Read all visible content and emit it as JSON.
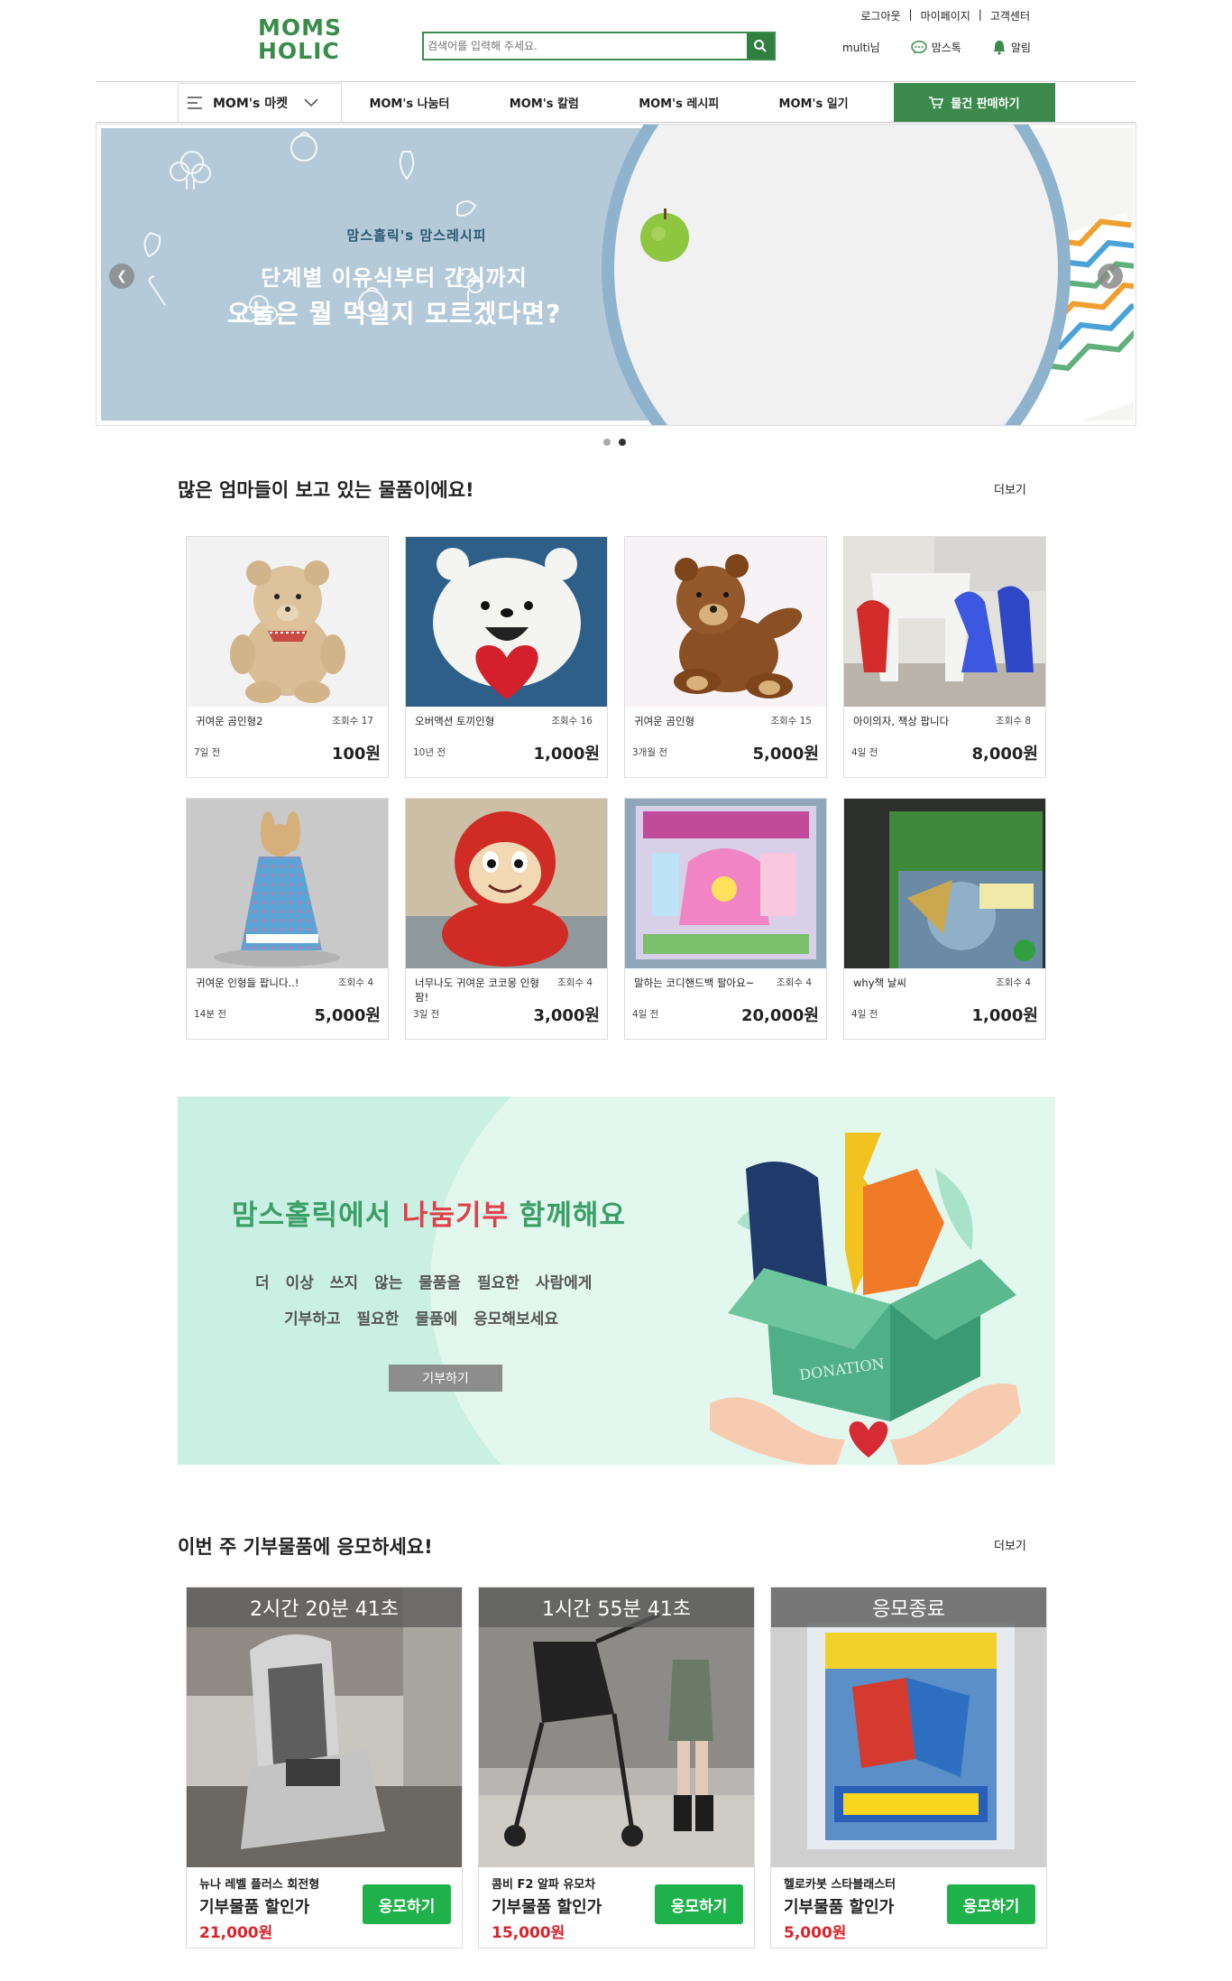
{
  "header": {
    "logo_line1": "MOMS",
    "logo_line2": "HOLIC",
    "search_placeholder": "검색어를 입력해 주세요.",
    "top_links": [
      "로그아웃",
      "마이페이지",
      "고객센터"
    ],
    "username": "multi님",
    "chat_label": "맘스톡",
    "alarm_label": "알림"
  },
  "nav": {
    "category": "MOM's 마켓",
    "items": [
      "MOM's 나눔터",
      "MOM's 칼럼",
      "MOM's 레시피",
      "MOM's 일기"
    ],
    "sell_button": "물건 판매하기"
  },
  "hero": {
    "small": "맘스홀릭's 맘스레시피",
    "line1": "단계별 이유식부터 간식까지",
    "line2": "오늘은 뭘 먹일지 모르겠다면?",
    "slides": 2,
    "active_slide": 2
  },
  "popular": {
    "title": "많은 엄마들이 보고 있는 물품이에요!",
    "more": "더보기",
    "items": [
      {
        "name": "귀여운 곰인형2",
        "views": "조회수 17",
        "time": "7일 전",
        "price": "100원"
      },
      {
        "name": "오버액션 토끼인형",
        "views": "조회수 16",
        "time": "10년 전",
        "price": "1,000원"
      },
      {
        "name": "귀여운 곰인형",
        "views": "조회수 15",
        "time": "3개월 전",
        "price": "5,000원"
      },
      {
        "name": "아이의자, 책상 팝니다",
        "views": "조회수 8",
        "time": "4일 전",
        "price": "8,000원"
      },
      {
        "name": "귀여운 인형들 팝니다..!",
        "views": "조회수 4",
        "time": "14분 전",
        "price": "5,000원"
      },
      {
        "name": "너무나도 귀여운 코코몽 인형 팜!",
        "views": "조회수 4",
        "time": "3일 전",
        "price": "3,000원"
      },
      {
        "name": "말하는 코디핸드백 팔아요~",
        "views": "조회수 4",
        "time": "4일 전",
        "price": "20,000원"
      },
      {
        "name": "why책 날씨",
        "views": "조회수 4",
        "time": "4일 전",
        "price": "1,000원"
      }
    ]
  },
  "donation_banner": {
    "title_a": "맘스홀릭에서 ",
    "title_b": "나눔기부",
    "title_c": " 함께해요",
    "line1": "더 이상 쓰지 않는 물품을 필요한 사람에게",
    "line2": "기부하고 필요한 물품에 응모해보세요",
    "button": "기부하기",
    "box_label": "DONATION"
  },
  "donation": {
    "title": "이번 주 기부물품에 응모하세요!",
    "more": "더보기",
    "items": [
      {
        "timer": "2시간 20분 41초",
        "name": "뉴나 레벨 플러스 회전형",
        "label": "기부물품 할인가",
        "price": "21,000원",
        "button": "응모하기"
      },
      {
        "timer": "1시간 55분 41초",
        "name": "콤비 F2 알파 유모차",
        "label": "기부물품 할인가",
        "price": "15,000원",
        "button": "응모하기"
      },
      {
        "timer": "응모종료",
        "name": "헬로카봇 스타블래스터",
        "label": "기부물품 할인가",
        "price": "5,000원",
        "button": "응모하기"
      }
    ]
  },
  "colors": {
    "brand_green": "#3a8c4a",
    "apply_green": "#1fb24a",
    "price_red": "#d8232a"
  }
}
